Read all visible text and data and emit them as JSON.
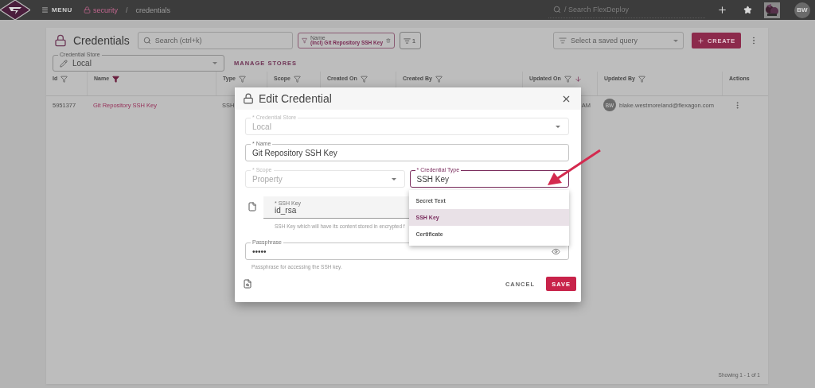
{
  "top_bar": {
    "menu_label": "MENU",
    "breadcrumb": [
      {
        "label": "security",
        "kind": "link"
      },
      {
        "label": "credentials",
        "kind": "current"
      }
    ],
    "breadcrumb_separator": "/",
    "search_placeholder": "/ Search FlexDeploy",
    "user_initials": "BW"
  },
  "page": {
    "title": "Credentials",
    "search_placeholder": "Search (ctrl+k)",
    "filter_chip": {
      "label": "Name",
      "value": "(Incl) Git Repository SSH Key"
    },
    "sort_count": "1",
    "saved_query_placeholder": "Select a saved query",
    "create_label": "CREATE",
    "store_select": {
      "label": "Credential Store",
      "value": "Local"
    },
    "manage_stores_label": "MANAGE STORES"
  },
  "table": {
    "columns": [
      {
        "label": "Id",
        "kind": "filter",
        "filtered": false,
        "sorted": false
      },
      {
        "label": "Name",
        "kind": "filter",
        "filtered": true,
        "sorted": false
      },
      {
        "label": "Type",
        "kind": "filter",
        "filtered": false,
        "sorted": false
      },
      {
        "label": "Scope",
        "kind": "filter",
        "filtered": false,
        "sorted": false
      },
      {
        "label": "Created On",
        "kind": "filter",
        "filtered": false,
        "sorted": false
      },
      {
        "label": "Created By",
        "kind": "filter",
        "filtered": false,
        "sorted": false
      },
      {
        "label": "Updated On",
        "kind": "filter",
        "filtered": false,
        "sorted": true
      },
      {
        "label": "Updated By",
        "kind": "filter",
        "filtered": false,
        "sorted": false
      },
      {
        "label": "Actions",
        "kind": "plain"
      }
    ],
    "rows": [
      {
        "id": "5951377",
        "name": "Git Repository SSH Key",
        "type": "SSH",
        "updated_on": "AM",
        "updated_by": {
          "initials": "BW",
          "email": "blake.westmoreland@flexagon.com"
        }
      }
    ],
    "footer": "Showing 1 - 1 of 1"
  },
  "dialog": {
    "title": "Edit Credential",
    "fields": [
      {
        "kind": "select",
        "label": "* Credential Store",
        "value": "Local",
        "disabled": true,
        "focused": false,
        "half": false
      },
      {
        "kind": "text",
        "label": "* Name",
        "value": "Git Repository SSH Key",
        "disabled": false,
        "focused": false,
        "half": false
      },
      {
        "kind": "select",
        "label": "* Scope",
        "value": "Property",
        "disabled": true,
        "focused": false,
        "half": true
      },
      {
        "kind": "select",
        "label": "* Credential Type",
        "value": "SSH Key",
        "disabled": false,
        "focused": true,
        "half": true,
        "open": true
      },
      {
        "kind": "file",
        "label": "* SSH Key",
        "value": "id_rsa",
        "helper": "SSH Key which will have its content stored in encrypted f",
        "half": false
      },
      {
        "kind": "password",
        "label": "Passphrase",
        "value": "•••••",
        "helper": "Passphrase for accessing the SSH key.",
        "half": false
      }
    ],
    "menu": [
      {
        "label": "Secret Text",
        "selected": false
      },
      {
        "label": "SSH Key",
        "selected": true
      },
      {
        "label": "Certificate",
        "selected": false
      }
    ],
    "buttons": [
      {
        "label": "CANCEL",
        "kind": "text"
      },
      {
        "label": "SAVE",
        "kind": "primary"
      }
    ]
  }
}
